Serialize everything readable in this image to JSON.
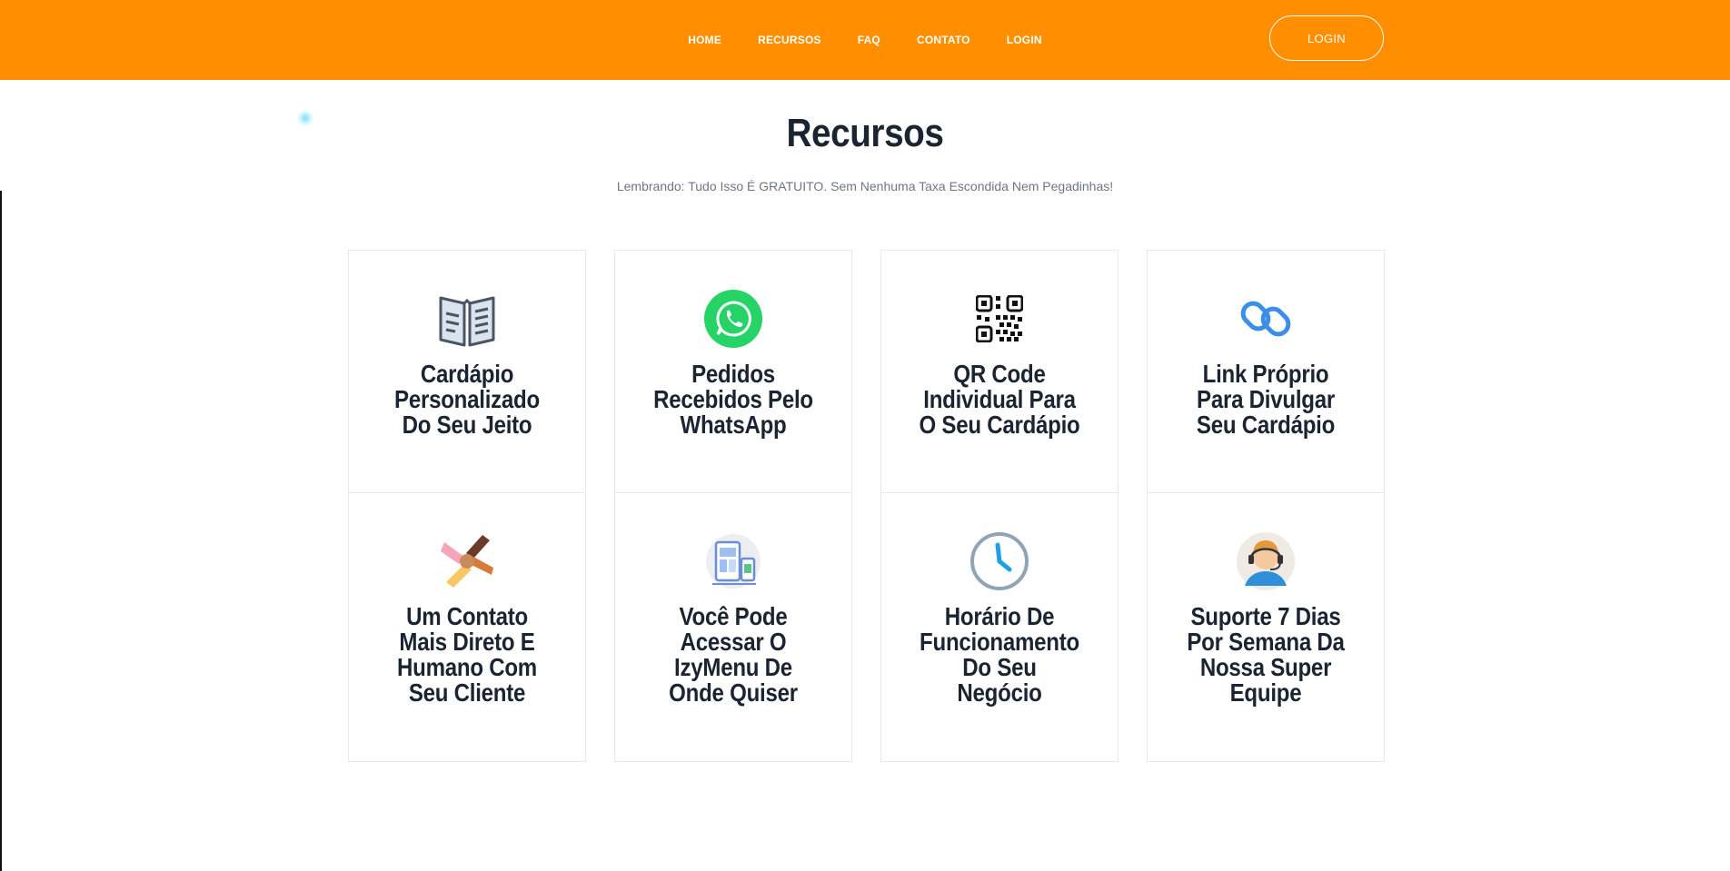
{
  "header": {
    "nav": [
      "HOME",
      "RECURSOS",
      "FAQ",
      "CONTATO",
      "LOGIN"
    ],
    "login_button": "LOGIN",
    "bg_color": "#ff8f00"
  },
  "section": {
    "title": "Recursos",
    "subtitle": "Lembrando: Tudo Isso É GRATUITO. Sem Nenhuma Taxa Escondida Nem Pegadinhas!"
  },
  "features": [
    {
      "icon": "menu-book-icon",
      "label": "Cardápio Personalizado Do Seu Jeito"
    },
    {
      "icon": "whatsapp-icon",
      "label": "Pedidos Recebidos Pelo WhatsApp"
    },
    {
      "icon": "qr-code-icon",
      "label": "QR Code Individual Para O Seu Cardápio"
    },
    {
      "icon": "link-icon",
      "label": "Link Próprio Para Divulgar Seu Cardápio"
    },
    {
      "icon": "hands-together-icon",
      "label": "Um Contato Mais Direto E Humano Com Seu Cliente"
    },
    {
      "icon": "devices-icon",
      "label": "Você Pode Acessar O IzyMenu De Onde Quiser"
    },
    {
      "icon": "clock-icon",
      "label": "Horário De Funcionamento Do Seu Negócio"
    },
    {
      "icon": "support-agent-icon",
      "label": "Suporte 7 Dias Por Semana Da Nossa Super Equipe"
    }
  ]
}
